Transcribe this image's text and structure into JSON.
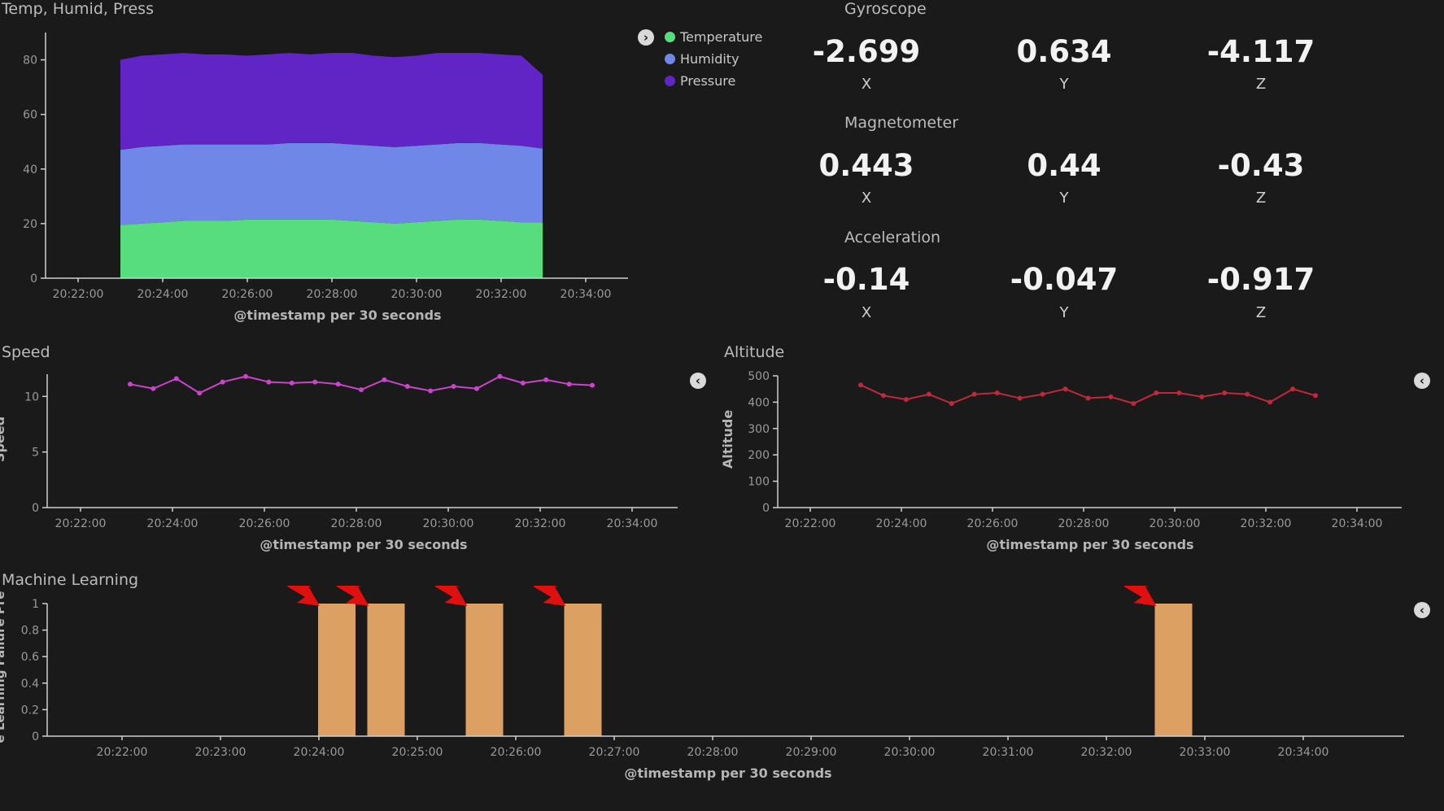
{
  "panels": {
    "temp": {
      "title": "Temp, Humid, Press",
      "xlabel": "@timestamp per 30 seconds",
      "legend": [
        {
          "label": "Temperature",
          "color": "#57dd7d"
        },
        {
          "label": "Humidity",
          "color": "#6f87e6"
        },
        {
          "label": "Pressure",
          "color": "#6125c6"
        }
      ]
    },
    "speed": {
      "title": "Speed",
      "ylabel": "Speed",
      "xlabel": "@timestamp per 30 seconds"
    },
    "altitude": {
      "title": "Altitude",
      "ylabel": "Altitude",
      "xlabel": "@timestamp per 30 seconds"
    },
    "ml": {
      "title": "Machine Learning",
      "ylabel": "e Learning Failure Pre",
      "xlabel": "@timestamp per 30 seconds"
    }
  },
  "metrics": [
    {
      "title": "Gyroscope",
      "values": [
        {
          "value": "-2.699",
          "label": "X"
        },
        {
          "value": "0.634",
          "label": "Y"
        },
        {
          "value": "-4.117",
          "label": "Z"
        }
      ]
    },
    {
      "title": "Magnetometer",
      "values": [
        {
          "value": "0.443",
          "label": "X"
        },
        {
          "value": "0.44",
          "label": "Y"
        },
        {
          "value": "-0.43",
          "label": "Z"
        }
      ]
    },
    {
      "title": "Acceleration",
      "values": [
        {
          "value": "-0.14",
          "label": "X"
        },
        {
          "value": "-0.047",
          "label": "Y"
        },
        {
          "value": "-0.917",
          "label": "Z"
        }
      ]
    }
  ],
  "icons": {
    "legend_toggle": "chevron-right-icon",
    "collapse_legend": "chevron-left-icon",
    "annotation_arrow": "red-arrow-icon"
  },
  "colors": {
    "background": "#1a1a1a",
    "speed_line": "#cc44cc",
    "altitude_line": "#c0283c",
    "ml_bar": "#dba062",
    "arrow": "#e01010"
  },
  "chart_data": [
    {
      "type": "area",
      "stacked": true,
      "x": [
        "20:23:00",
        "20:23:30",
        "20:24:00",
        "20:24:30",
        "20:25:00",
        "20:25:30",
        "20:26:00",
        "20:26:30",
        "20:27:00",
        "20:27:30",
        "20:28:00",
        "20:28:30",
        "20:29:00",
        "20:29:30",
        "20:30:00",
        "20:30:30",
        "20:31:00",
        "20:31:30",
        "20:32:00",
        "20:32:30",
        "20:33:00"
      ],
      "x_ticks": [
        "20:22:00",
        "20:24:00",
        "20:26:00",
        "20:28:00",
        "20:30:00",
        "20:32:00",
        "20:34:00"
      ],
      "series": [
        {
          "name": "Temperature",
          "values": [
            19.5,
            20,
            20.5,
            21,
            21,
            21,
            21.5,
            21.5,
            21.5,
            21.5,
            21.5,
            21,
            20.5,
            20,
            20.5,
            21,
            21.5,
            21.5,
            21,
            20.5,
            20.5
          ]
        },
        {
          "name": "Humidity",
          "values": [
            27.5,
            28,
            28,
            28,
            28,
            28,
            27.5,
            27.5,
            28,
            28,
            28,
            28,
            28,
            28,
            28,
            28,
            28,
            28,
            28,
            28,
            27
          ]
        },
        {
          "name": "Pressure",
          "values": [
            33,
            33.5,
            33.5,
            33.5,
            33,
            33,
            32.5,
            33,
            33,
            32.5,
            33,
            33.5,
            33,
            33,
            33,
            33.5,
            33,
            33,
            33,
            33,
            27
          ]
        }
      ],
      "ylim": [
        0,
        90
      ],
      "y_ticks": [
        0,
        20,
        40,
        60,
        80
      ]
    },
    {
      "type": "line",
      "series": [
        {
          "name": "Speed",
          "values": [
            [
              0,
              11.1
            ],
            [
              0.5,
              10.7
            ],
            [
              1,
              11.6
            ],
            [
              1.5,
              10.3
            ],
            [
              2,
              11.3
            ],
            [
              2.5,
              11.8
            ],
            [
              3,
              11.3
            ],
            [
              3.5,
              11.2
            ],
            [
              4,
              11.3
            ],
            [
              4.5,
              11.1
            ],
            [
              5,
              10.6
            ],
            [
              5.5,
              11.5
            ],
            [
              6,
              10.9
            ],
            [
              6.5,
              10.5
            ],
            [
              7,
              10.9
            ],
            [
              7.5,
              10.7
            ],
            [
              8,
              11.8
            ],
            [
              8.5,
              11.2
            ],
            [
              9,
              11.5
            ],
            [
              9.5,
              11.1
            ],
            [
              10,
              11
            ]
          ]
        }
      ],
      "x_ticks": [
        "20:22:00",
        "20:24:00",
        "20:26:00",
        "20:28:00",
        "20:30:00",
        "20:32:00",
        "20:34:00"
      ],
      "ylabel": "Speed",
      "ylim": [
        0,
        12
      ],
      "y_ticks": [
        0,
        5,
        10
      ]
    },
    {
      "type": "line",
      "series": [
        {
          "name": "Altitude",
          "values": [
            [
              0,
              465
            ],
            [
              0.5,
              425
            ],
            [
              1,
              410
            ],
            [
              1.5,
              430
            ],
            [
              2,
              395
            ],
            [
              2.5,
              430
            ],
            [
              3,
              435
            ],
            [
              3.5,
              415
            ],
            [
              4,
              430
            ],
            [
              4.5,
              450
            ],
            [
              5,
              415
            ],
            [
              5.5,
              420
            ],
            [
              6,
              395
            ],
            [
              6.5,
              435
            ],
            [
              7,
              435
            ],
            [
              7.5,
              420
            ],
            [
              8,
              435
            ],
            [
              8.5,
              430
            ],
            [
              9,
              400
            ],
            [
              9.5,
              450
            ],
            [
              10,
              425
            ]
          ]
        }
      ],
      "x_ticks": [
        "20:22:00",
        "20:24:00",
        "20:26:00",
        "20:28:00",
        "20:30:00",
        "20:32:00",
        "20:34:00"
      ],
      "ylabel": "Altitude",
      "ylim": [
        0,
        500
      ],
      "y_ticks": [
        0,
        100,
        200,
        300,
        400,
        500
      ]
    },
    {
      "type": "bar",
      "categories": [
        "20:24:00",
        "20:24:30",
        "20:25:30",
        "20:26:30",
        "20:32:30"
      ],
      "values": [
        1,
        1,
        1,
        1,
        1
      ],
      "x_ticks": [
        "20:22:00",
        "20:23:00",
        "20:24:00",
        "20:25:00",
        "20:26:00",
        "20:27:00",
        "20:28:00",
        "20:29:00",
        "20:30:00",
        "20:31:00",
        "20:32:00",
        "20:33:00",
        "20:34:00"
      ],
      "ylabel": "e Learning Failure Pre",
      "ylim": [
        0,
        1
      ],
      "y_ticks": [
        0,
        0.2,
        0.4,
        0.6,
        0.8,
        1
      ]
    }
  ]
}
